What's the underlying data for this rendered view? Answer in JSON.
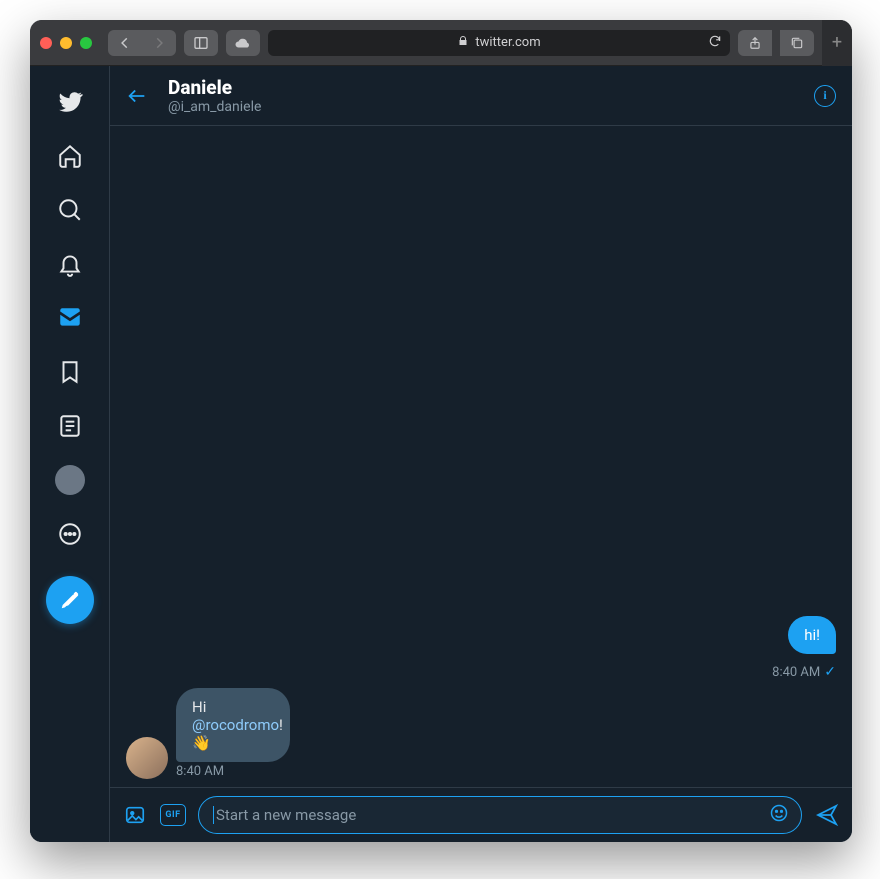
{
  "browser": {
    "url_display": "twitter.com"
  },
  "header": {
    "name": "Daniele",
    "handle": "@i_am_daniele"
  },
  "messages": {
    "out1": {
      "text": "hi!",
      "time": "8:40 AM"
    },
    "in1": {
      "prefix": "Hi ",
      "mention": "@rocodromo",
      "suffix": "! 👋",
      "time": "8:40 AM"
    }
  },
  "composer": {
    "placeholder": "Start a new message",
    "gif_label": "GIF"
  }
}
